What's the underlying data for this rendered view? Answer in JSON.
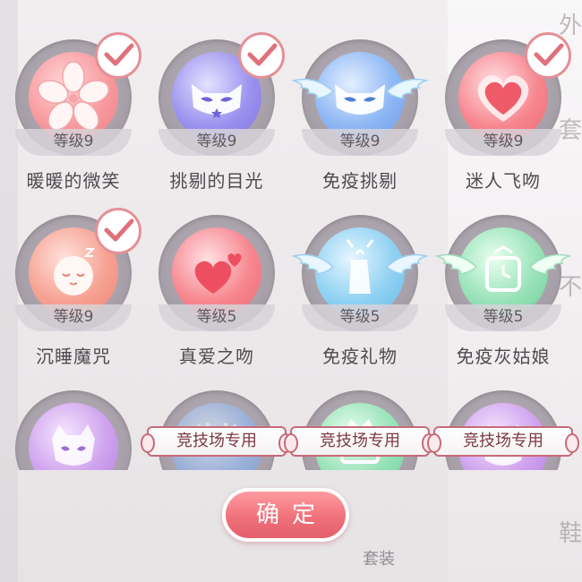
{
  "background": {
    "side_tabs": [
      "外",
      "套",
      "不",
      "鞋"
    ],
    "bottom_label": "套装"
  },
  "skills": [
    {
      "name": "暖暖的微笑",
      "level": "等级9",
      "icon": "sakura-icon",
      "color": "pink",
      "selected": true,
      "wings": false
    },
    {
      "name": "挑剔的目光",
      "level": "等级9",
      "icon": "mask-icon",
      "color": "purple",
      "selected": true,
      "wings": false
    },
    {
      "name": "免疫挑剔",
      "level": "等级9",
      "icon": "winged-mask-icon",
      "color": "blue",
      "selected": false,
      "wings": true
    },
    {
      "name": "迷人飞吻",
      "level": "等级9",
      "icon": "heart-icon",
      "color": "red",
      "selected": true,
      "wings": false
    },
    {
      "name": "沉睡魔咒",
      "level": "等级9",
      "icon": "sleeping-face-icon",
      "color": "coral",
      "selected": true,
      "wings": false
    },
    {
      "name": "真爱之吻",
      "level": "等级5",
      "icon": "hearts-icon",
      "color": "red",
      "selected": false,
      "wings": false
    },
    {
      "name": "免疫礼物",
      "level": "等级5",
      "icon": "winged-gift-icon",
      "color": "sky",
      "selected": false,
      "wings": true
    },
    {
      "name": "免疫灰姑娘",
      "level": "等级5",
      "icon": "winged-clock-icon",
      "color": "mint",
      "selected": false,
      "wings": true
    }
  ],
  "arena_skills": [
    {
      "label": "",
      "icon": "cat-mask-icon",
      "color": "lilac"
    },
    {
      "label": "竞技场专用",
      "icon": "antler-icon",
      "color": "blue"
    },
    {
      "label": "竞技场专用",
      "icon": "crown-icon",
      "color": "mint"
    },
    {
      "label": "竞技场专用",
      "icon": "cat-mask-icon",
      "color": "lilac"
    }
  ],
  "confirm_label": "确定",
  "colors": {
    "accent": "#ef6e78",
    "check": "#e58f96",
    "ribbon_border": "#c66a78"
  }
}
